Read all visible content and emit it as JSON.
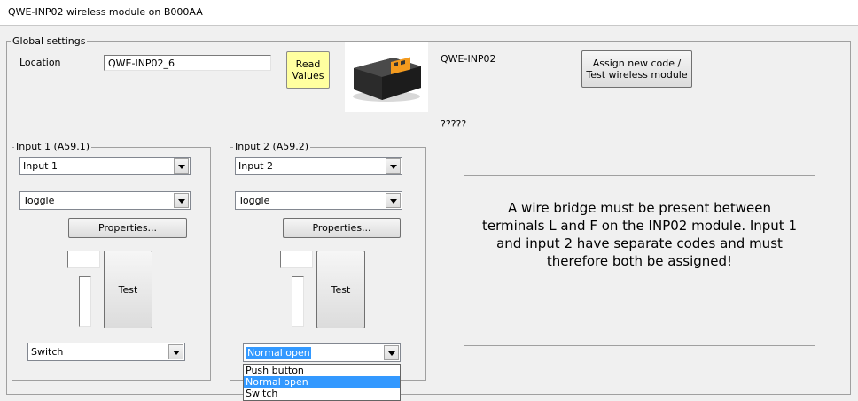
{
  "window": {
    "title": "QWE-INP02 wireless module on B000AA"
  },
  "global": {
    "group_label": "Global settings",
    "location_label": "Location",
    "location_value": "QWE-INP02_6",
    "read_values_label": "Read\nValues",
    "model": "QWE-INP02",
    "assign_button": "Assign new code /\nTest wireless module",
    "status": "?????"
  },
  "input1": {
    "group_label": "Input 1 (A59.1)",
    "name_value": "Input 1",
    "mode_value": "Toggle",
    "properties_label": "Properties...",
    "test_label": "Test",
    "type_value": "Switch"
  },
  "input2": {
    "group_label": "Input 2 (A59.2)",
    "name_value": "Input 2",
    "mode_value": "Toggle",
    "properties_label": "Properties...",
    "test_label": "Test",
    "type_value": "Normal open",
    "type_options": [
      "Push button",
      "Normal open",
      "Switch"
    ],
    "selected_option": "Normal open"
  },
  "info": {
    "text": "A wire bridge must be present between terminals L and F on the INP02 module. Input 1 and input 2 have separate codes and must therefore both be assigned!"
  },
  "colors": {
    "selection": "#3399ff",
    "read_values_bg": "#ffffa0"
  }
}
